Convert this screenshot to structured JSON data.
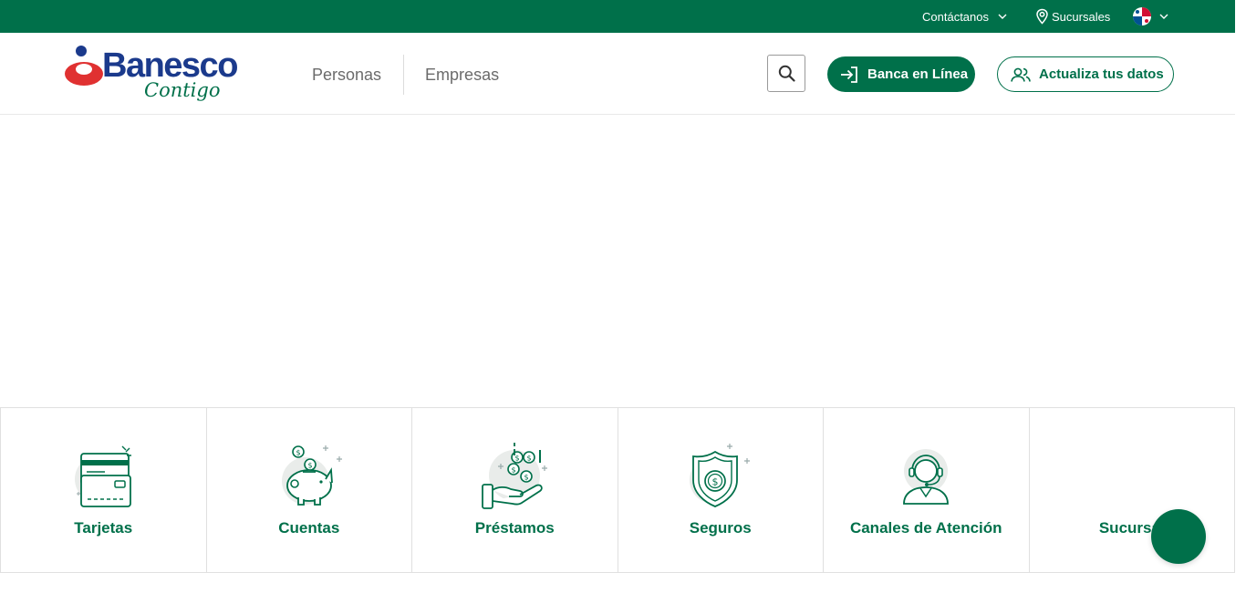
{
  "topbar": {
    "contact_label": "Contáctanos",
    "branches_label": "Sucursales",
    "language_flag": "panama-flag-icon"
  },
  "header": {
    "logo_text": "Banesco",
    "logo_tagline": "Contigo",
    "nav": [
      {
        "label": "Personas"
      },
      {
        "label": "Empresas"
      }
    ],
    "search_icon": "search-icon",
    "online_banking_label": "Banca en Línea",
    "update_data_label": "Actualiza tus datos"
  },
  "categories": [
    {
      "label": "Tarjetas",
      "icon": "credit-card-icon"
    },
    {
      "label": "Cuentas",
      "icon": "piggy-bank-icon"
    },
    {
      "label": "Préstamos",
      "icon": "hand-coins-icon"
    },
    {
      "label": "Seguros",
      "icon": "shield-dollar-icon"
    },
    {
      "label": "Canales de Atención",
      "icon": "headset-agent-icon"
    },
    {
      "label": "Sucursal",
      "icon": "branch-icon"
    }
  ],
  "colors": {
    "brand_green": "#00704a",
    "brand_blue": "#1b3a8c",
    "brand_red": "#e03131"
  }
}
